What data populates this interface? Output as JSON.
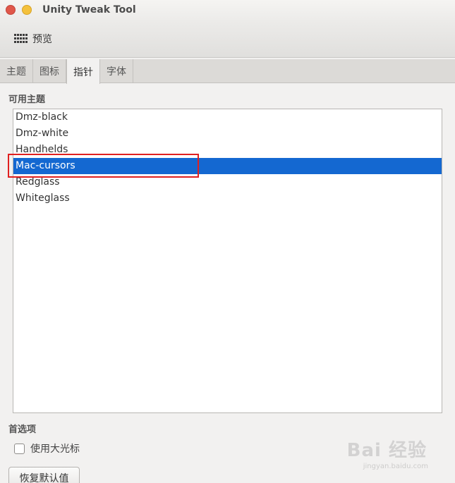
{
  "window": {
    "title": "Unity Tweak Tool"
  },
  "toolbar": {
    "preview_label": "预览"
  },
  "tabs": [
    {
      "label": "主题"
    },
    {
      "label": "图标"
    },
    {
      "label": "指针"
    },
    {
      "label": "字体"
    }
  ],
  "active_tab": "指针",
  "themes": {
    "section_label": "可用主题",
    "items": [
      "Dmz-black",
      "Dmz-white",
      "Handhelds",
      "Mac-cursors",
      "Redglass",
      "Whiteglass"
    ],
    "selected": "Mac-cursors"
  },
  "preferences": {
    "section_label": "首选项",
    "large_cursor_label": "使用大光标",
    "large_cursor_checked": false
  },
  "reset_button": {
    "label": "恢复默认值"
  },
  "watermark": {
    "logo": "Bai 经验",
    "url": "jingyan.baidu.com"
  },
  "colors": {
    "selection": "#1468d1",
    "annotation": "#e02020"
  }
}
